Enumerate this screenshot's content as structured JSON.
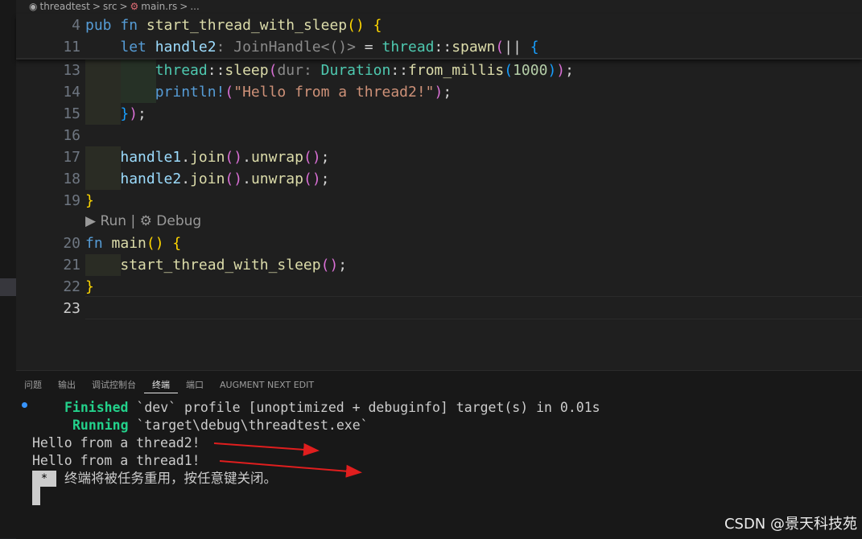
{
  "breadcrumb": {
    "project": "threadtest",
    "sep": ">",
    "folder": "src",
    "file": "main.rs",
    "tail": "..."
  },
  "sticky_lines": [
    {
      "num": "4",
      "tokens": [
        [
          "kw",
          "pub "
        ],
        [
          "kw",
          "fn "
        ],
        [
          "fn",
          "start_thread_with_sleep"
        ],
        [
          "p1",
          "()"
        ],
        [
          "op",
          " "
        ],
        [
          "p1",
          "{"
        ]
      ]
    },
    {
      "num": "11",
      "tokens": [
        [
          "op",
          "    "
        ],
        [
          "kw",
          "let "
        ],
        [
          "var",
          "handle2"
        ],
        [
          "hint",
          ": JoinHandle<()>"
        ],
        [
          "op",
          " = "
        ],
        [
          "mod",
          "thread"
        ],
        [
          "op",
          "::"
        ],
        [
          "fn",
          "spawn"
        ],
        [
          "p2",
          "("
        ],
        [
          "op",
          "|| "
        ],
        [
          "p3",
          "{"
        ]
      ]
    }
  ],
  "code_lines": [
    {
      "num": "13",
      "tokens": [
        [
          "op",
          "        "
        ],
        [
          "mod",
          "thread"
        ],
        [
          "op",
          "::"
        ],
        [
          "fn",
          "sleep"
        ],
        [
          "p2",
          "("
        ],
        [
          "hint",
          "dur: "
        ],
        [
          "ty",
          "Duration"
        ],
        [
          "op",
          "::"
        ],
        [
          "fn",
          "from_millis"
        ],
        [
          "p3",
          "("
        ],
        [
          "num",
          "1000"
        ],
        [
          "p3",
          ")"
        ],
        [
          "p2",
          ")"
        ],
        [
          "op",
          ";"
        ]
      ]
    },
    {
      "num": "14",
      "tokens": [
        [
          "op",
          "        "
        ],
        [
          "mac",
          "println!"
        ],
        [
          "p2",
          "("
        ],
        [
          "str",
          "\"Hello from a thread2!\""
        ],
        [
          "p2",
          ")"
        ],
        [
          "op",
          ";"
        ]
      ]
    },
    {
      "num": "15",
      "tokens": [
        [
          "op",
          "    "
        ],
        [
          "p3",
          "}"
        ],
        [
          "p2",
          ")"
        ],
        [
          "op",
          ";"
        ]
      ]
    },
    {
      "num": "16",
      "tokens": []
    },
    {
      "num": "17",
      "tokens": [
        [
          "op",
          "    "
        ],
        [
          "var",
          "handle1"
        ],
        [
          "op",
          "."
        ],
        [
          "fn",
          "join"
        ],
        [
          "p2",
          "()"
        ],
        [
          "op",
          "."
        ],
        [
          "fn",
          "unwrap"
        ],
        [
          "p2",
          "()"
        ],
        [
          "op",
          ";"
        ]
      ]
    },
    {
      "num": "18",
      "tokens": [
        [
          "op",
          "    "
        ],
        [
          "var",
          "handle2"
        ],
        [
          "op",
          "."
        ],
        [
          "fn",
          "join"
        ],
        [
          "p2",
          "()"
        ],
        [
          "op",
          "."
        ],
        [
          "fn",
          "unwrap"
        ],
        [
          "p2",
          "()"
        ],
        [
          "op",
          ";"
        ]
      ]
    },
    {
      "num": "19",
      "tokens": [
        [
          "p1",
          "}"
        ]
      ]
    },
    {
      "num": "20",
      "tokens": [
        [
          "kw",
          "fn "
        ],
        [
          "fn",
          "main"
        ],
        [
          "p1",
          "()"
        ],
        [
          "op",
          " "
        ],
        [
          "p1",
          "{"
        ]
      ]
    },
    {
      "num": "21",
      "tokens": [
        [
          "op",
          "    "
        ],
        [
          "fn",
          "start_thread_with_sleep"
        ],
        [
          "p2",
          "()"
        ],
        [
          "op",
          ";"
        ]
      ]
    },
    {
      "num": "22",
      "tokens": [
        [
          "p1",
          "}"
        ]
      ]
    },
    {
      "num": "23",
      "tokens": []
    }
  ],
  "codelens": {
    "run_icon": "play-icon",
    "run": "Run",
    "sep": "|",
    "debug_icon": "gear-icon",
    "debug": "Debug"
  },
  "panel_tabs": [
    "问题",
    "输出",
    "调试控制台",
    "终端",
    "端口",
    "AUGMENT NEXT EDIT"
  ],
  "active_tab": "终端",
  "terminal": {
    "line1_status": "Finished",
    "line1_rest": " `dev` profile [unoptimized + debuginfo] target(s) in 0.01s",
    "line2_status": "Running",
    "line2_rest": " `target\\debug\\threadtest.exe`",
    "line3": "Hello from a thread2!",
    "line4": "Hello from a thread1!",
    "star": "*",
    "notice": "终端将被任务重用，按任意键关闭。"
  },
  "watermark": "CSDN @景天科技苑",
  "colors": {
    "editor_bg": "#1f1f1f",
    "panel_bg": "#181818",
    "accent_blue": "#3794ff",
    "arrow_red": "#e01e1e"
  }
}
